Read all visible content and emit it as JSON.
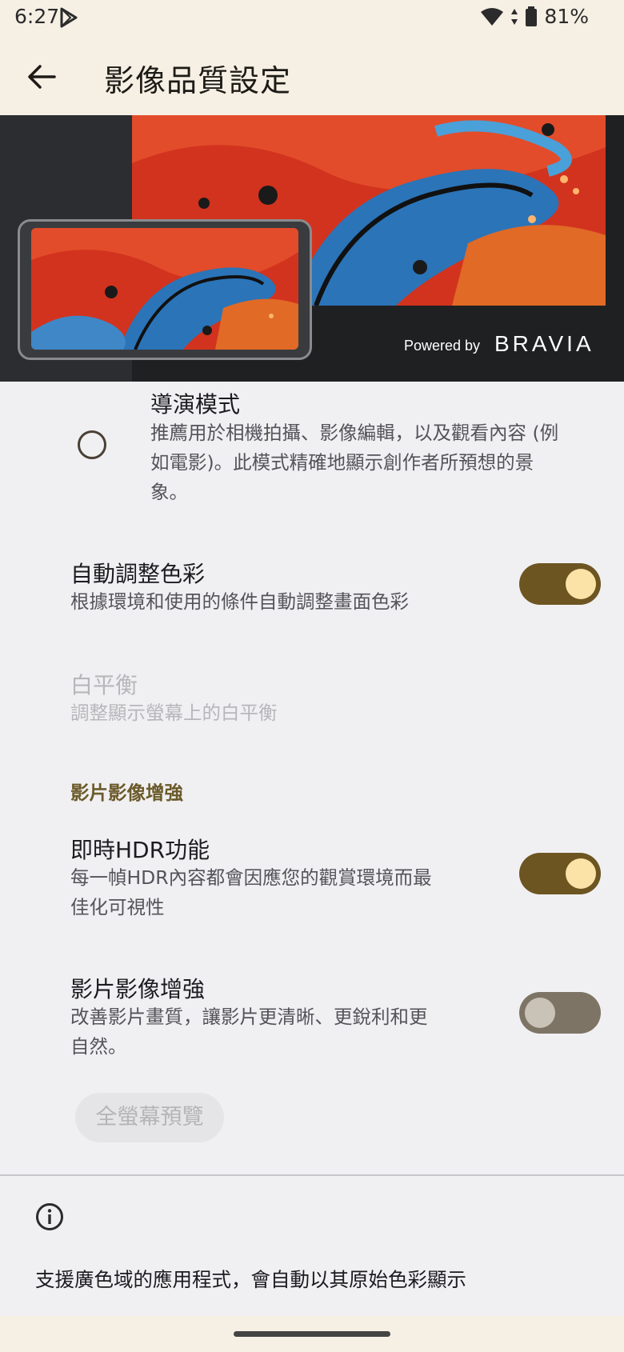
{
  "status_bar": {
    "time": "6:27",
    "battery_percent": "81%",
    "icons": [
      "play-store-icon",
      "wifi-icon",
      "data-arrows-icon",
      "battery-icon"
    ]
  },
  "app_bar": {
    "title": "影像品質設定",
    "back_icon": "arrow-back-icon"
  },
  "hero": {
    "powered_by": "Powered by",
    "brand": "BRAVIA"
  },
  "director_mode": {
    "title": "導演模式",
    "description_lines": [
      "推薦用於相機拍攝、影像編輯，以及觀看內容 (例",
      "如電影)。此模式精確地顯示創作者所預想的景",
      "象。"
    ],
    "selected": false
  },
  "auto_color": {
    "title": "自動調整色彩",
    "description": "根據環境和使用的條件自動調整畫面色彩",
    "enabled": true
  },
  "white_balance": {
    "title": "白平衡",
    "description": "調整顯示螢幕上的白平衡",
    "disabled": true
  },
  "video_section": {
    "header": "影片影像增強"
  },
  "realtime_hdr": {
    "title": "即時HDR功能",
    "description_lines": [
      "每一幀HDR內容都會因應您的觀賞環境而最",
      "佳化可視性"
    ],
    "enabled": true
  },
  "video_enhance": {
    "title": "影片影像增強",
    "description_lines": [
      "改善影片畫質，讓影片更清晰、更銳利和更",
      "自然。"
    ],
    "enabled": false
  },
  "preview_button": {
    "label": "全螢幕預覽"
  },
  "footer": {
    "info_icon": "info-icon",
    "text": "支援廣色域的應用程式，會自動以其原始色彩顯示"
  },
  "colors": {
    "accent_toggle_on": "#6d5522",
    "knob_on": "#fbe2a6",
    "toggle_off": "#7d7466",
    "section_header": "#6b5a2a",
    "app_bar_bg": "#f6efe4"
  }
}
